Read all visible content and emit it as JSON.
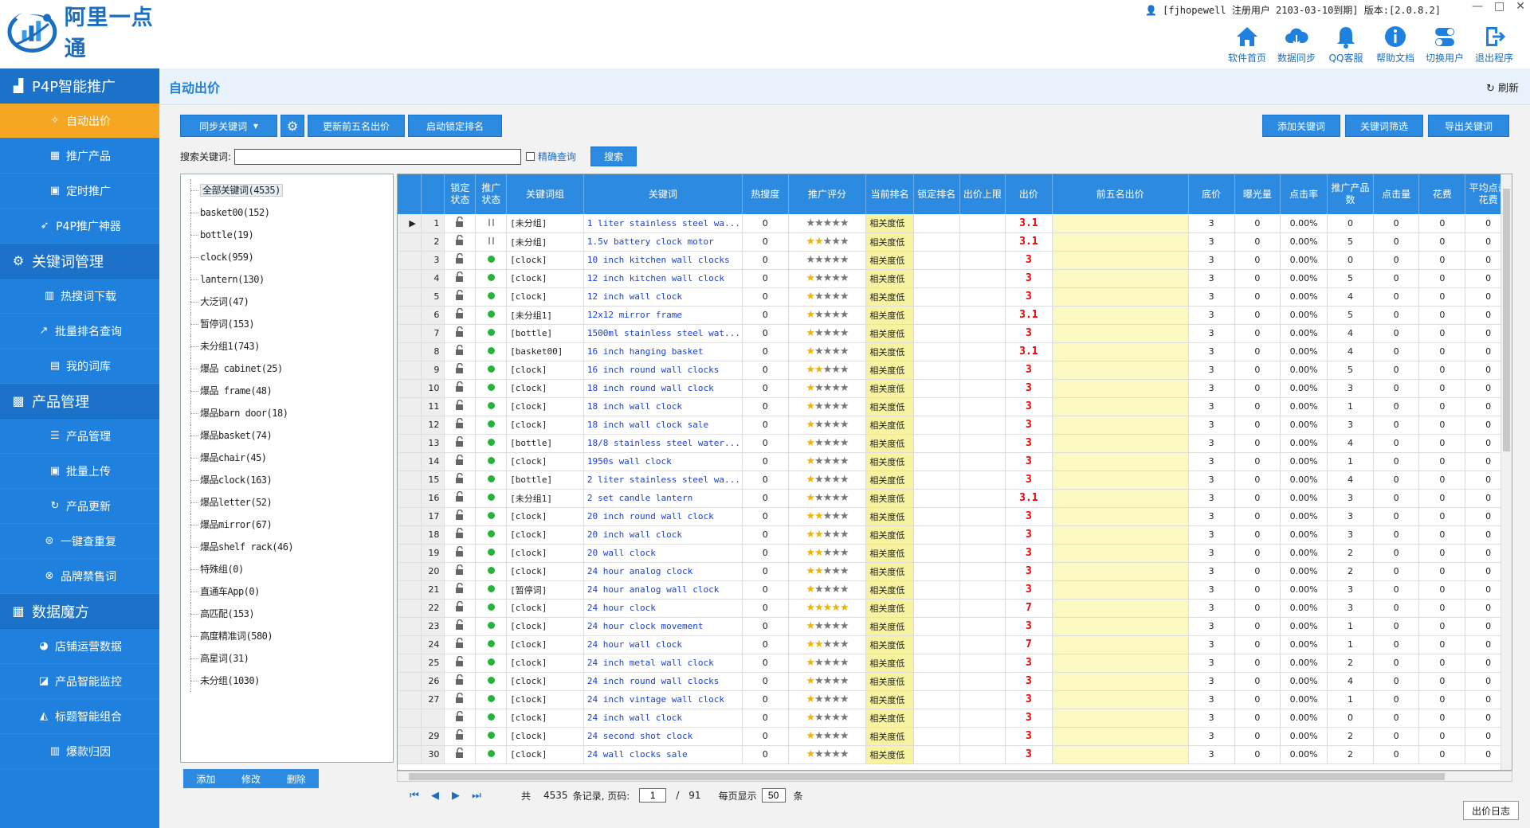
{
  "app": {
    "brand": "阿里一点通",
    "accent": "#1f80dd",
    "active_color": "#f5a623"
  },
  "user_info": "[fjhopewell 注册用户 2103-03-10到期] 版本:[2.0.8.2]",
  "window_controls": [
    "—",
    "□",
    "✕"
  ],
  "topnav": [
    {
      "label": "软件首页",
      "icon": "home-icon"
    },
    {
      "label": "数据同步",
      "icon": "cloud-sync-icon"
    },
    {
      "label": "QQ客服",
      "icon": "bell-icon"
    },
    {
      "label": "帮助文档",
      "icon": "info-icon"
    },
    {
      "label": "切换用户",
      "icon": "switch-user-icon"
    },
    {
      "label": "退出程序",
      "icon": "exit-icon"
    }
  ],
  "sidebar": {
    "sections": [
      {
        "title": "P4P智能推广",
        "icon": "bar-chart-icon",
        "items": [
          {
            "label": "自动出价",
            "icon": "magic-wand-icon",
            "active": true
          },
          {
            "label": "推广产品",
            "icon": "grid-icon"
          },
          {
            "label": "定时推广",
            "icon": "calendar-icon"
          },
          {
            "label": "P4P推广神器",
            "icon": "rocket-icon"
          }
        ]
      },
      {
        "title": "关键词管理",
        "icon": "chip-icon",
        "items": [
          {
            "label": "热搜词下载",
            "icon": "chart-icon"
          },
          {
            "label": "批量排名查询",
            "icon": "trend-icon"
          },
          {
            "label": "我的词库",
            "icon": "building-icon"
          }
        ]
      },
      {
        "title": "产品管理",
        "icon": "box-icon",
        "items": [
          {
            "label": "产品管理",
            "icon": "list-icon"
          },
          {
            "label": "批量上传",
            "icon": "upload-icon"
          },
          {
            "label": "产品更新",
            "icon": "refresh-icon"
          },
          {
            "label": "一键查重复",
            "icon": "duplicate-icon"
          },
          {
            "label": "品牌禁售词",
            "icon": "ban-icon"
          }
        ]
      },
      {
        "title": "数据魔方",
        "icon": "apps-icon",
        "items": [
          {
            "label": "店铺运营数据",
            "icon": "pie-icon"
          },
          {
            "label": "产品智能监控",
            "icon": "monitor-icon"
          },
          {
            "label": "标题智能组合",
            "icon": "combine-icon"
          },
          {
            "label": "爆款归因",
            "icon": "analysis-icon"
          }
        ]
      }
    ]
  },
  "page": {
    "title": "自动出价",
    "refresh": "刷新"
  },
  "toolbar": {
    "sync_keywords": "同步关键词",
    "update_top5": "更新前五名出价",
    "start_lock": "启动锁定排名",
    "add_keyword": "添加关键词",
    "filter_keyword": "关键词筛选",
    "export_keyword": "导出关键词"
  },
  "search": {
    "label": "搜索关键词:",
    "value": "",
    "exact_label": "精确查询",
    "button": "搜索"
  },
  "tree": [
    "全部关键词(4535)",
    "basket00(152)",
    "bottle(19)",
    "clock(959)",
    "lantern(130)",
    "大泛词(47)",
    "暂停词(153)",
    "未分组1(743)",
    "爆品 cabinet(25)",
    "爆品 frame(48)",
    "爆品barn door(18)",
    "爆品basket(74)",
    "爆品chair(45)",
    "爆品clock(163)",
    "爆品letter(52)",
    "爆品mirror(67)",
    "爆品shelf  rack(46)",
    "特殊组(0)",
    "直通车App(0)",
    "高匹配(153)",
    "高度精准词(580)",
    "高星词(31)",
    "未分组(1030)"
  ],
  "tree_buttons": [
    "添加",
    "修改",
    "删除"
  ],
  "columns": [
    "锁定状态",
    "推广状态",
    "关键词组",
    "关键词",
    "热搜度",
    "推广评分",
    "当前排名",
    "锁定排名",
    "出价上限",
    "出价",
    "前五名出价",
    "底价",
    "曝光量",
    "点击率",
    "推广产品数",
    "点击量",
    "花费",
    "平均点击花费"
  ],
  "rows": [
    {
      "n": "1",
      "st": "pause",
      "grp": "[未分组]",
      "kw": "1 liter stainless steel wa...",
      "hot": "0",
      "stars": 0,
      "rank": "相关度低",
      "bid": "3.1",
      "floor": "3",
      "exp": "0",
      "ctr": "0.00%",
      "prod": "0",
      "clk": "0",
      "cost": "0",
      "avg": "0"
    },
    {
      "n": "2",
      "st": "pause",
      "grp": "[未分组]",
      "kw": "1.5v battery clock motor",
      "hot": "0",
      "stars": 2,
      "rank": "相关度低",
      "bid": "3.1",
      "floor": "3",
      "exp": "0",
      "ctr": "0.00%",
      "prod": "5",
      "clk": "0",
      "cost": "0",
      "avg": "0"
    },
    {
      "n": "3",
      "st": "on",
      "grp": "[clock]",
      "kw": "10 inch kitchen wall clocks",
      "hot": "0",
      "stars": 0,
      "rank": "相关度低",
      "bid": "3",
      "floor": "3",
      "exp": "0",
      "ctr": "0.00%",
      "prod": "0",
      "clk": "0",
      "cost": "0",
      "avg": "0"
    },
    {
      "n": "4",
      "st": "on",
      "grp": "[clock]",
      "kw": "12 inch kitchen wall clock",
      "hot": "0",
      "stars": 1,
      "rank": "相关度低",
      "bid": "3",
      "floor": "3",
      "exp": "0",
      "ctr": "0.00%",
      "prod": "5",
      "clk": "0",
      "cost": "0",
      "avg": "0"
    },
    {
      "n": "5",
      "st": "on",
      "grp": "[clock]",
      "kw": "12 inch wall clock",
      "hot": "0",
      "stars": 1,
      "rank": "相关度低",
      "bid": "3",
      "floor": "3",
      "exp": "0",
      "ctr": "0.00%",
      "prod": "4",
      "clk": "0",
      "cost": "0",
      "avg": "0"
    },
    {
      "n": "6",
      "st": "on",
      "grp": "[未分组1]",
      "kw": "12x12 mirror frame",
      "hot": "0",
      "stars": 1,
      "rank": "相关度低",
      "bid": "3.1",
      "floor": "3",
      "exp": "0",
      "ctr": "0.00%",
      "prod": "5",
      "clk": "0",
      "cost": "0",
      "avg": "0"
    },
    {
      "n": "7",
      "st": "on",
      "grp": "[bottle]",
      "kw": "1500ml stainless steel wat...",
      "hot": "0",
      "stars": 1,
      "rank": "相关度低",
      "bid": "3",
      "floor": "3",
      "exp": "0",
      "ctr": "0.00%",
      "prod": "4",
      "clk": "0",
      "cost": "0",
      "avg": "0"
    },
    {
      "n": "8",
      "st": "on",
      "grp": "[basket00]",
      "kw": "16 inch hanging basket",
      "hot": "0",
      "stars": 1,
      "rank": "相关度低",
      "bid": "3.1",
      "floor": "3",
      "exp": "0",
      "ctr": "0.00%",
      "prod": "4",
      "clk": "0",
      "cost": "0",
      "avg": "0"
    },
    {
      "n": "9",
      "st": "on",
      "grp": "[clock]",
      "kw": "16 inch round wall clocks",
      "hot": "0",
      "stars": 2,
      "rank": "相关度低",
      "bid": "3",
      "floor": "3",
      "exp": "0",
      "ctr": "0.00%",
      "prod": "5",
      "clk": "0",
      "cost": "0",
      "avg": "0"
    },
    {
      "n": "10",
      "st": "on",
      "grp": "[clock]",
      "kw": "18 inch round wall clock",
      "hot": "0",
      "stars": 1,
      "rank": "相关度低",
      "bid": "3",
      "floor": "3",
      "exp": "0",
      "ctr": "0.00%",
      "prod": "3",
      "clk": "0",
      "cost": "0",
      "avg": "0"
    },
    {
      "n": "11",
      "st": "on",
      "grp": "[clock]",
      "kw": "18 inch wall clock",
      "hot": "0",
      "stars": 1,
      "rank": "相关度低",
      "bid": "3",
      "floor": "3",
      "exp": "0",
      "ctr": "0.00%",
      "prod": "1",
      "clk": "0",
      "cost": "0",
      "avg": "0"
    },
    {
      "n": "12",
      "st": "on",
      "grp": "[clock]",
      "kw": "18 inch wall clock sale",
      "hot": "0",
      "stars": 1,
      "rank": "相关度低",
      "bid": "3",
      "floor": "3",
      "exp": "0",
      "ctr": "0.00%",
      "prod": "3",
      "clk": "0",
      "cost": "0",
      "avg": "0"
    },
    {
      "n": "13",
      "st": "on",
      "grp": "[bottle]",
      "kw": "18/8 stainless steel water...",
      "hot": "0",
      "stars": 1,
      "rank": "相关度低",
      "bid": "3",
      "floor": "3",
      "exp": "0",
      "ctr": "0.00%",
      "prod": "4",
      "clk": "0",
      "cost": "0",
      "avg": "0"
    },
    {
      "n": "14",
      "st": "on",
      "grp": "[clock]",
      "kw": "1950s wall clock",
      "hot": "0",
      "stars": 1,
      "rank": "相关度低",
      "bid": "3",
      "floor": "3",
      "exp": "0",
      "ctr": "0.00%",
      "prod": "1",
      "clk": "0",
      "cost": "0",
      "avg": "0"
    },
    {
      "n": "15",
      "st": "on",
      "grp": "[bottle]",
      "kw": "2 liter stainless steel wa...",
      "hot": "0",
      "stars": 1,
      "rank": "相关度低",
      "bid": "3",
      "floor": "3",
      "exp": "0",
      "ctr": "0.00%",
      "prod": "4",
      "clk": "0",
      "cost": "0",
      "avg": "0"
    },
    {
      "n": "16",
      "st": "on",
      "grp": "[未分组1]",
      "kw": "2 set candle lantern",
      "hot": "0",
      "stars": 1,
      "rank": "相关度低",
      "bid": "3.1",
      "floor": "3",
      "exp": "0",
      "ctr": "0.00%",
      "prod": "3",
      "clk": "0",
      "cost": "0",
      "avg": "0"
    },
    {
      "n": "17",
      "st": "on",
      "grp": "[clock]",
      "kw": "20 inch round wall clock",
      "hot": "0",
      "stars": 2,
      "rank": "相关度低",
      "bid": "3",
      "floor": "3",
      "exp": "0",
      "ctr": "0.00%",
      "prod": "3",
      "clk": "0",
      "cost": "0",
      "avg": "0"
    },
    {
      "n": "18",
      "st": "on",
      "grp": "[clock]",
      "kw": "20 inch wall clock",
      "hot": "0",
      "stars": 2,
      "rank": "相关度低",
      "bid": "3",
      "floor": "3",
      "exp": "0",
      "ctr": "0.00%",
      "prod": "3",
      "clk": "0",
      "cost": "0",
      "avg": "0"
    },
    {
      "n": "19",
      "st": "on",
      "grp": "[clock]",
      "kw": "20 wall clock",
      "hot": "0",
      "stars": 2,
      "rank": "相关度低",
      "bid": "3",
      "floor": "3",
      "exp": "0",
      "ctr": "0.00%",
      "prod": "2",
      "clk": "0",
      "cost": "0",
      "avg": "0"
    },
    {
      "n": "20",
      "st": "on",
      "grp": "[clock]",
      "kw": "24 hour analog clock",
      "hot": "0",
      "stars": 2,
      "rank": "相关度低",
      "bid": "3",
      "floor": "3",
      "exp": "0",
      "ctr": "0.00%",
      "prod": "2",
      "clk": "0",
      "cost": "0",
      "avg": "0"
    },
    {
      "n": "21",
      "st": "on",
      "grp": "[暂停词]",
      "kw": "24 hour analog wall clock",
      "hot": "0",
      "stars": 1,
      "rank": "相关度低",
      "bid": "3",
      "floor": "3",
      "exp": "0",
      "ctr": "0.00%",
      "prod": "3",
      "clk": "0",
      "cost": "0",
      "avg": "0"
    },
    {
      "n": "22",
      "st": "on",
      "grp": "[clock]",
      "kw": "24 hour clock",
      "hot": "0",
      "stars": 5,
      "rank": "相关度低",
      "bid": "7",
      "floor": "3",
      "exp": "0",
      "ctr": "0.00%",
      "prod": "3",
      "clk": "0",
      "cost": "0",
      "avg": "0"
    },
    {
      "n": "23",
      "st": "on",
      "grp": "[clock]",
      "kw": "24 hour clock movement",
      "hot": "0",
      "stars": 1,
      "rank": "相关度低",
      "bid": "3",
      "floor": "3",
      "exp": "0",
      "ctr": "0.00%",
      "prod": "1",
      "clk": "0",
      "cost": "0",
      "avg": "0"
    },
    {
      "n": "24",
      "st": "on",
      "grp": "[clock]",
      "kw": "24 hour wall clock",
      "hot": "0",
      "stars": 2,
      "rank": "相关度低",
      "bid": "7",
      "floor": "3",
      "exp": "0",
      "ctr": "0.00%",
      "prod": "1",
      "clk": "0",
      "cost": "0",
      "avg": "0"
    },
    {
      "n": "25",
      "st": "on",
      "grp": "[clock]",
      "kw": "24 inch metal wall clock",
      "hot": "0",
      "stars": 1,
      "rank": "相关度低",
      "bid": "3",
      "floor": "3",
      "exp": "0",
      "ctr": "0.00%",
      "prod": "2",
      "clk": "0",
      "cost": "0",
      "avg": "0"
    },
    {
      "n": "26",
      "st": "on",
      "grp": "[clock]",
      "kw": "24 inch round wall clocks",
      "hot": "0",
      "stars": 1,
      "rank": "相关度低",
      "bid": "3",
      "floor": "3",
      "exp": "0",
      "ctr": "0.00%",
      "prod": "4",
      "clk": "0",
      "cost": "0",
      "avg": "0"
    },
    {
      "n": "27",
      "st": "on",
      "grp": "[clock]",
      "kw": "24 inch vintage wall clock",
      "hot": "0",
      "stars": 1,
      "rank": "相关度低",
      "bid": "3",
      "floor": "3",
      "exp": "0",
      "ctr": "0.00%",
      "prod": "1",
      "clk": "0",
      "cost": "0",
      "avg": "0"
    },
    {
      "n": "",
      "st": "on",
      "grp": "[clock]",
      "kw": "24 inch wall clock",
      "hot": "0",
      "stars": 1,
      "rank": "相关度低",
      "bid": "3",
      "floor": "3",
      "exp": "0",
      "ctr": "0.00%",
      "prod": "0",
      "clk": "0",
      "cost": "0",
      "avg": "0"
    },
    {
      "n": "29",
      "st": "on",
      "grp": "[clock]",
      "kw": "24 second shot clock",
      "hot": "0",
      "stars": 1,
      "rank": "相关度低",
      "bid": "3",
      "floor": "3",
      "exp": "0",
      "ctr": "0.00%",
      "prod": "2",
      "clk": "0",
      "cost": "0",
      "avg": "0"
    },
    {
      "n": "30",
      "st": "on",
      "grp": "[clock]",
      "kw": "24 wall clocks sale",
      "hot": "0",
      "stars": 1,
      "rank": "相关度低",
      "bid": "3",
      "floor": "3",
      "exp": "0",
      "ctr": "0.00%",
      "prod": "2",
      "clk": "0",
      "cost": "0",
      "avg": "0"
    }
  ],
  "pager": {
    "total_prefix": "共",
    "total": "4535",
    "records_label": "条记录, 页码:",
    "page": "1",
    "sep": "/",
    "pages": "91",
    "per_page_label": "每页显示",
    "per_page": "50",
    "unit": "条"
  },
  "log_button": "出价日志"
}
